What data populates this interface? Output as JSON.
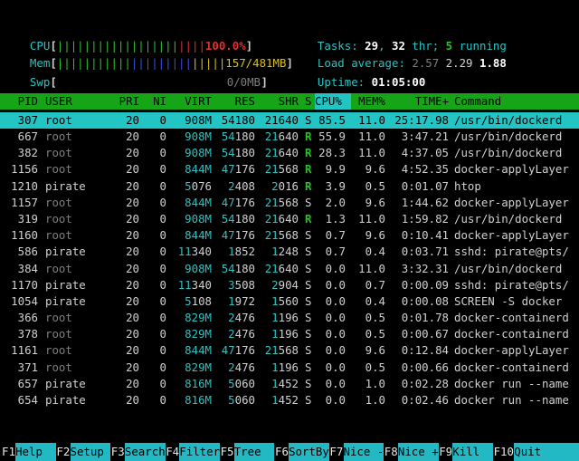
{
  "meters": {
    "cpu": {
      "label": "CPU",
      "bar_green": "||||||||||||||||||",
      "bar_red": "||||",
      "value": "100.0%"
    },
    "mem": {
      "label": "Mem",
      "bar_green": "|||||||||||",
      "bar_blue": "|||||||||",
      "bar_yellow": "|||||",
      "value": "157/481MB"
    },
    "swp": {
      "label": "Swp",
      "value": "0/0MB"
    }
  },
  "summary": {
    "tasks_label": "Tasks: ",
    "tasks": "29",
    "sep1": ", ",
    "threads": "32",
    "thr_label": " thr; ",
    "running": "5",
    "running_label": " running",
    "load_label": "Load average: ",
    "load1": "2.57",
    "load5": "2.29",
    "load15": "1.88",
    "uptime_label": "Uptime: ",
    "uptime": "01:05:00"
  },
  "columns": [
    "PID",
    "USER",
    "PRI",
    "NI",
    "VIRT",
    "RES",
    "SHR",
    "S",
    "CPU%",
    "MEM%",
    "TIME+",
    "Command"
  ],
  "selected": {
    "pid": "307",
    "user": "root",
    "pri": "20",
    "ni": "0",
    "virt": "908M",
    "res": "54180",
    "shr": "21640",
    "s": "S",
    "cpu": "85.5",
    "mem": "11.0",
    "time": "25:17.98",
    "cmd": "/usr/bin/dockerd"
  },
  "rows": [
    {
      "pid": "667",
      "user": "root",
      "pri": "20",
      "ni": "0",
      "virt": "908M",
      "res": "54180",
      "shr": "21640",
      "s": "R",
      "cpu": "55.9",
      "mem": "11.0",
      "time": "3:47.21",
      "cmd": "/usr/bin/dockerd"
    },
    {
      "pid": "382",
      "user": "root",
      "pri": "20",
      "ni": "0",
      "virt": "908M",
      "res": "54180",
      "shr": "21640",
      "s": "R",
      "cpu": "28.3",
      "mem": "11.0",
      "time": "4:37.05",
      "cmd": "/usr/bin/dockerd"
    },
    {
      "pid": "1156",
      "user": "root",
      "pri": "20",
      "ni": "0",
      "virt": "844M",
      "res": "47176",
      "shr": "21568",
      "s": "R",
      "cpu": "9.9",
      "mem": "9.6",
      "time": "4:52.35",
      "cmd": "docker-applyLayer"
    },
    {
      "pid": "1210",
      "user": "pirate",
      "pri": "20",
      "ni": "0",
      "virt": "5076",
      "res": "2408",
      "shr": "2016",
      "s": "R",
      "cpu": "3.9",
      "mem": "0.5",
      "time": "0:01.07",
      "cmd": "htop"
    },
    {
      "pid": "1157",
      "user": "root",
      "pri": "20",
      "ni": "0",
      "virt": "844M",
      "res": "47176",
      "shr": "21568",
      "s": "S",
      "cpu": "2.0",
      "mem": "9.6",
      "time": "1:44.62",
      "cmd": "docker-applyLayer"
    },
    {
      "pid": "319",
      "user": "root",
      "pri": "20",
      "ni": "0",
      "virt": "908M",
      "res": "54180",
      "shr": "21640",
      "s": "R",
      "cpu": "1.3",
      "mem": "11.0",
      "time": "1:59.82",
      "cmd": "/usr/bin/dockerd"
    },
    {
      "pid": "1160",
      "user": "root",
      "pri": "20",
      "ni": "0",
      "virt": "844M",
      "res": "47176",
      "shr": "21568",
      "s": "S",
      "cpu": "0.7",
      "mem": "9.6",
      "time": "0:10.41",
      "cmd": "docker-applyLayer"
    },
    {
      "pid": "586",
      "user": "pirate",
      "pri": "20",
      "ni": "0",
      "virt": "11340",
      "res": "1852",
      "shr": "1248",
      "s": "S",
      "cpu": "0.7",
      "mem": "0.4",
      "time": "0:03.71",
      "cmd": "sshd: pirate@pts/"
    },
    {
      "pid": "384",
      "user": "root",
      "pri": "20",
      "ni": "0",
      "virt": "908M",
      "res": "54180",
      "shr": "21640",
      "s": "S",
      "cpu": "0.0",
      "mem": "11.0",
      "time": "3:32.31",
      "cmd": "/usr/bin/dockerd"
    },
    {
      "pid": "1170",
      "user": "pirate",
      "pri": "20",
      "ni": "0",
      "virt": "11340",
      "res": "3508",
      "shr": "2904",
      "s": "S",
      "cpu": "0.0",
      "mem": "0.7",
      "time": "0:00.09",
      "cmd": "sshd: pirate@pts/"
    },
    {
      "pid": "1054",
      "user": "pirate",
      "pri": "20",
      "ni": "0",
      "virt": "5108",
      "res": "1972",
      "shr": "1560",
      "s": "S",
      "cpu": "0.0",
      "mem": "0.4",
      "time": "0:00.08",
      "cmd": "SCREEN -S docker"
    },
    {
      "pid": "366",
      "user": "root",
      "pri": "20",
      "ni": "0",
      "virt": "829M",
      "res": "2476",
      "shr": "1196",
      "s": "S",
      "cpu": "0.0",
      "mem": "0.5",
      "time": "0:01.78",
      "cmd": "docker-containerd"
    },
    {
      "pid": "378",
      "user": "root",
      "pri": "20",
      "ni": "0",
      "virt": "829M",
      "res": "2476",
      "shr": "1196",
      "s": "S",
      "cpu": "0.0",
      "mem": "0.5",
      "time": "0:00.67",
      "cmd": "docker-containerd"
    },
    {
      "pid": "1161",
      "user": "root",
      "pri": "20",
      "ni": "0",
      "virt": "844M",
      "res": "47176",
      "shr": "21568",
      "s": "S",
      "cpu": "0.0",
      "mem": "9.6",
      "time": "0:12.84",
      "cmd": "docker-applyLayer"
    },
    {
      "pid": "371",
      "user": "root",
      "pri": "20",
      "ni": "0",
      "virt": "829M",
      "res": "2476",
      "shr": "1196",
      "s": "S",
      "cpu": "0.0",
      "mem": "0.5",
      "time": "0:00.66",
      "cmd": "docker-containerd"
    },
    {
      "pid": "657",
      "user": "pirate",
      "pri": "20",
      "ni": "0",
      "virt": "816M",
      "res": "5060",
      "shr": "1452",
      "s": "S",
      "cpu": "0.0",
      "mem": "1.0",
      "time": "0:02.28",
      "cmd": "docker run --name"
    },
    {
      "pid": "654",
      "user": "pirate",
      "pri": "20",
      "ni": "0",
      "virt": "816M",
      "res": "5060",
      "shr": "1452",
      "s": "S",
      "cpu": "0.0",
      "mem": "1.0",
      "time": "0:02.46",
      "cmd": "docker run --name"
    }
  ],
  "footer": [
    {
      "key": "F1",
      "label": "Help  "
    },
    {
      "key": "F2",
      "label": "Setup "
    },
    {
      "key": "F3",
      "label": "Search"
    },
    {
      "key": "F4",
      "label": "Filter"
    },
    {
      "key": "F5",
      "label": "Tree  "
    },
    {
      "key": "F6",
      "label": "SortBy"
    },
    {
      "key": "F7",
      "label": "Nice -"
    },
    {
      "key": "F8",
      "label": "Nice +"
    },
    {
      "key": "F9",
      "label": "Kill  "
    },
    {
      "key": "F10",
      "label": "Quit"
    }
  ],
  "colors": {
    "header_bg": "#16a516",
    "selected_bg": "#22c4c4",
    "accent_cyan": "#2bc2c2",
    "accent_green": "#2ec02e",
    "accent_red": "#e03030",
    "footer_label_bg": "#22b8c4"
  }
}
